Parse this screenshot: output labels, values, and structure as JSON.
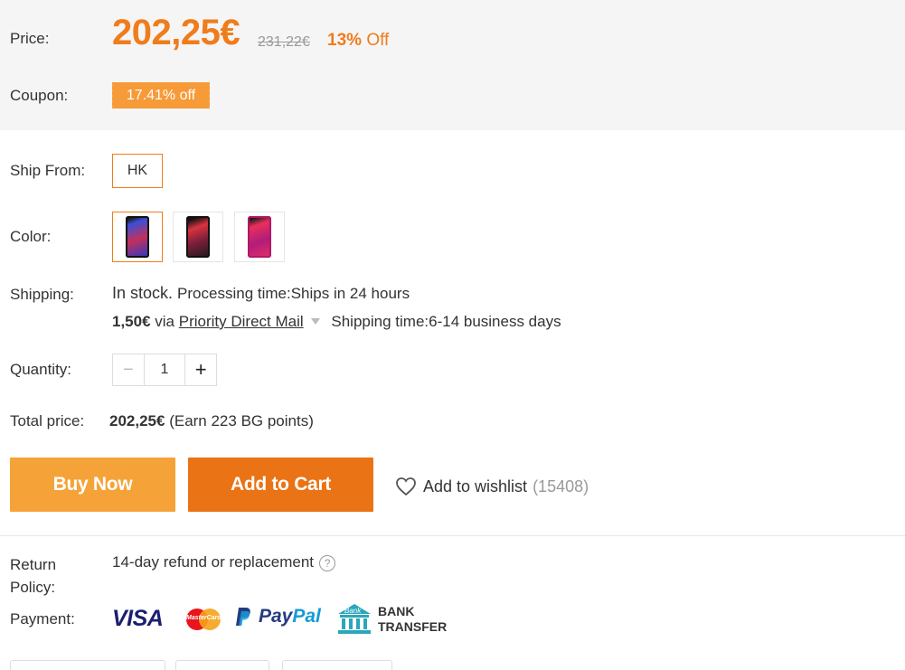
{
  "price": {
    "label": "Price:",
    "current": "202,25€",
    "original": "231,22€",
    "discount_pct": "13%",
    "discount_word": "Off"
  },
  "coupon": {
    "label": "Coupon:",
    "value": "17.41% off"
  },
  "ship_from": {
    "label": "Ship From:",
    "selected": "HK"
  },
  "color": {
    "label": "Color:",
    "options": [
      "aurora-blue",
      "black",
      "twilight-pink"
    ],
    "selected_index": 0
  },
  "shipping": {
    "label": "Shipping:",
    "stock": "In stock.",
    "processing": "Processing time:Ships in 24 hours",
    "cost": "1,50€",
    "via": "via",
    "method": "Priority Direct Mail",
    "time": "Shipping time:6-14 business days"
  },
  "quantity": {
    "label": "Quantity:",
    "minus": "−",
    "value": "1",
    "plus": "+"
  },
  "total": {
    "label": "Total price:",
    "value": "202,25€",
    "points": "(Earn 223 BG points)"
  },
  "actions": {
    "buy_now": "Buy Now",
    "add_to_cart": "Add to Cart",
    "wishlist": "Add to wishlist",
    "wishlist_count": "(15408)"
  },
  "return_policy": {
    "label_line1": "Return",
    "label_line2": "Policy:",
    "text": "14-day refund or replacement",
    "help": "?"
  },
  "payment": {
    "label": "Payment:",
    "visa": "VISA",
    "mastercard": "MasterCard",
    "paypal_p1": "Pay",
    "paypal_p2": "Pal",
    "bank_icon_text": "Bank",
    "bank_line1": "BANK",
    "bank_line2": "TRANSFER"
  },
  "colors": {
    "accent": "#f07c1b",
    "buy_now": "#f5a338",
    "add_to_cart": "#ea7315",
    "visa": "#1a1f71",
    "paypal_dark": "#253b80",
    "paypal_light": "#179bd7",
    "bank": "#2aa7b8"
  }
}
